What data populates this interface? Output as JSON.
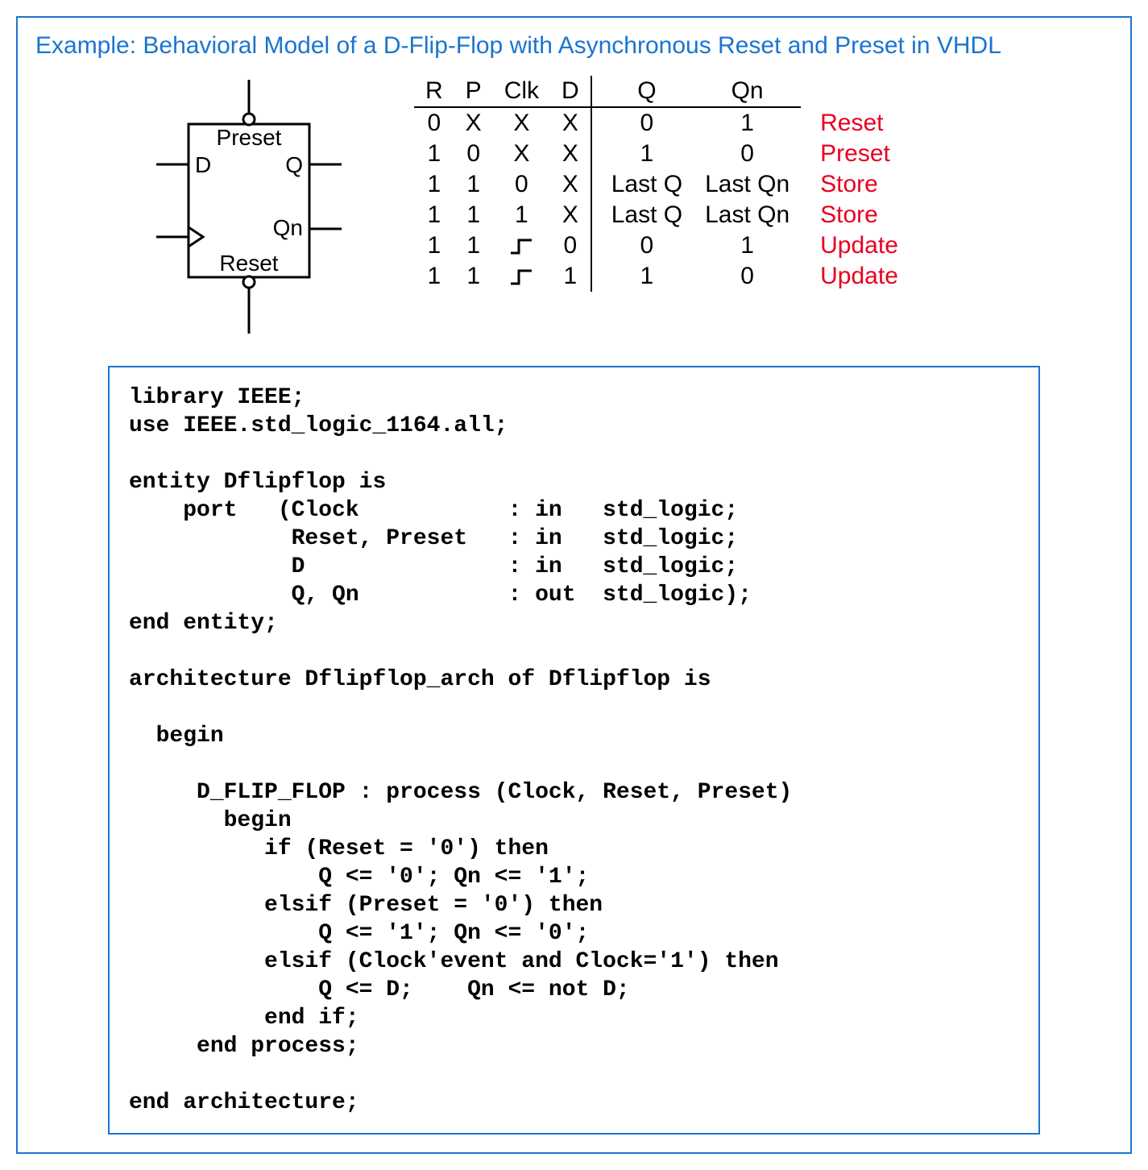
{
  "title": "Example: Behavioral Model of a D-Flip-Flop with Asynchronous Reset and Preset in VHDL",
  "diagram": {
    "preset": "Preset",
    "reset": "Reset",
    "d": "D",
    "q": "Q",
    "qn": "Qn"
  },
  "table": {
    "headers": [
      "R",
      "P",
      "Clk",
      "D",
      "Q",
      "Qn"
    ],
    "rows": [
      {
        "r": "0",
        "p": "X",
        "clk": "X",
        "d": "X",
        "q": "0",
        "qn": "1",
        "comment": "Reset"
      },
      {
        "r": "1",
        "p": "0",
        "clk": "X",
        "d": "X",
        "q": "1",
        "qn": "0",
        "comment": "Preset"
      },
      {
        "r": "1",
        "p": "1",
        "clk": "0",
        "d": "X",
        "q": "Last Q",
        "qn": "Last Qn",
        "comment": "Store"
      },
      {
        "r": "1",
        "p": "1",
        "clk": "1",
        "d": "X",
        "q": "Last Q",
        "qn": "Last Qn",
        "comment": "Store"
      },
      {
        "r": "1",
        "p": "1",
        "clk": "edge",
        "d": "0",
        "q": "0",
        "qn": "1",
        "comment": "Update"
      },
      {
        "r": "1",
        "p": "1",
        "clk": "edge",
        "d": "1",
        "q": "1",
        "qn": "0",
        "comment": "Update"
      }
    ]
  },
  "code": "library IEEE;\nuse IEEE.std_logic_1164.all;\n\nentity Dflipflop is\n    port   (Clock           : in   std_logic;\n            Reset, Preset   : in   std_logic;\n            D               : in   std_logic;\n            Q, Qn           : out  std_logic);\nend entity;\n\narchitecture Dflipflop_arch of Dflipflop is\n\n  begin\n\n     D_FLIP_FLOP : process (Clock, Reset, Preset)\n       begin\n          if (Reset = '0') then\n              Q <= '0'; Qn <= '1';\n          elsif (Preset = '0') then\n              Q <= '1'; Qn <= '0';\n          elsif (Clock'event and Clock='1') then\n              Q <= D;    Qn <= not D;\n          end if;\n     end process;\n\nend architecture;"
}
